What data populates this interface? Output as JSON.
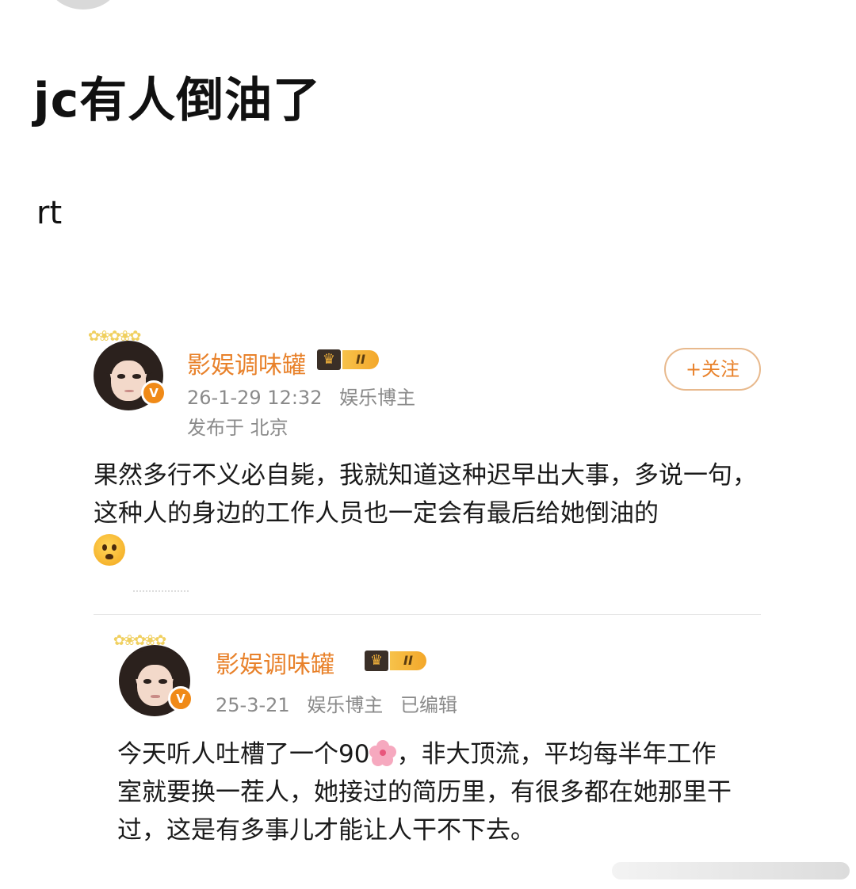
{
  "post": {
    "title": "jc有人倒油了",
    "body": "rt"
  },
  "quoted_cards": [
    {
      "username": "影娱调味罐",
      "level_badge": "II",
      "timestamp": "26-1-29 12:32",
      "tag": "娱乐博主",
      "location": "发布于 北京",
      "follow_label": "+关注",
      "text": "果然多行不义必自毙，我就知道这种迟早出大事，多说一句，这种人的身边的工作人员也一定会有最后给她倒油的",
      "emoji": "frowning-face-emoji"
    },
    {
      "username": "影娱调味罐",
      "level_badge": "II",
      "timestamp": "25-3-21",
      "tag": "娱乐博主",
      "edited": "已编辑",
      "text_part1": "今天听人吐槽了一个90",
      "text_part2": "，非大顶流，平均每半年工作室就要换一茬人，她接过的简历里，有很多都在她那里干过，这是有多事儿才能让人干不下去。",
      "emoji": "cherry-blossom-emoji"
    }
  ],
  "colors": {
    "username": "#e8812a",
    "meta": "#8a8a8a",
    "badge": "#f08a17"
  }
}
